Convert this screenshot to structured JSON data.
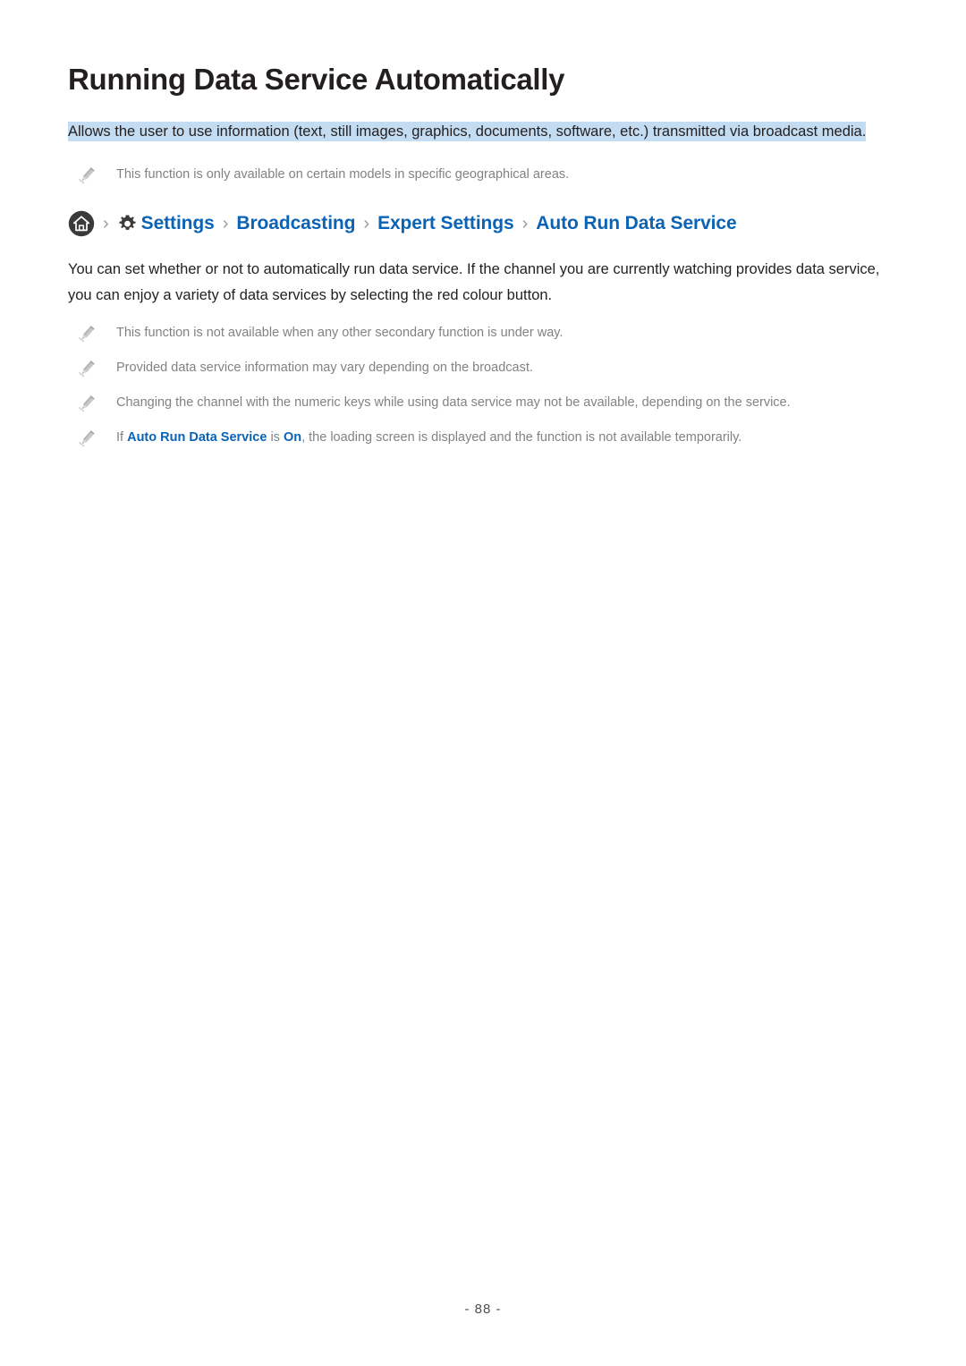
{
  "document": {
    "title": "Running Data Service Automatically",
    "intro_highlighted": "Allows the user to use information (text, still images, graphics, documents, software, etc.) transmitted via broadcast media.",
    "body_paragraph": "You can set whether or not to automatically run data service. If the channel you are currently watching provides data service, you can enjoy a variety of data services by selecting the red colour button.",
    "page_number": "- 88 -"
  },
  "notes_top": [
    {
      "text": "This function is only available on certain models in specific geographical areas."
    }
  ],
  "breadcrumb": {
    "home_icon": "home-icon",
    "gear_icon": "gear-icon",
    "separator": "›",
    "items": [
      {
        "label": "Settings"
      },
      {
        "label": "Broadcasting"
      },
      {
        "label": "Expert Settings"
      },
      {
        "label": "Auto Run Data Service"
      }
    ]
  },
  "notes_bottom": [
    {
      "text": "This function is not available when any other secondary function is under way."
    },
    {
      "text": "Provided data service information may vary depending on the broadcast."
    },
    {
      "text": "Changing the channel with the numeric keys while using data service may not be available, depending on the service."
    }
  ],
  "note_inline": {
    "prefix": "If ",
    "term1": "Auto Run Data Service",
    "middle": " is ",
    "term2": "On",
    "suffix": ", the loading screen is displayed and the function is not available temporarily."
  },
  "colors": {
    "link_blue": "#0b63b5",
    "highlight": "#c3dcf2",
    "note_gray": "#828282",
    "text_dark": "#231f20"
  }
}
